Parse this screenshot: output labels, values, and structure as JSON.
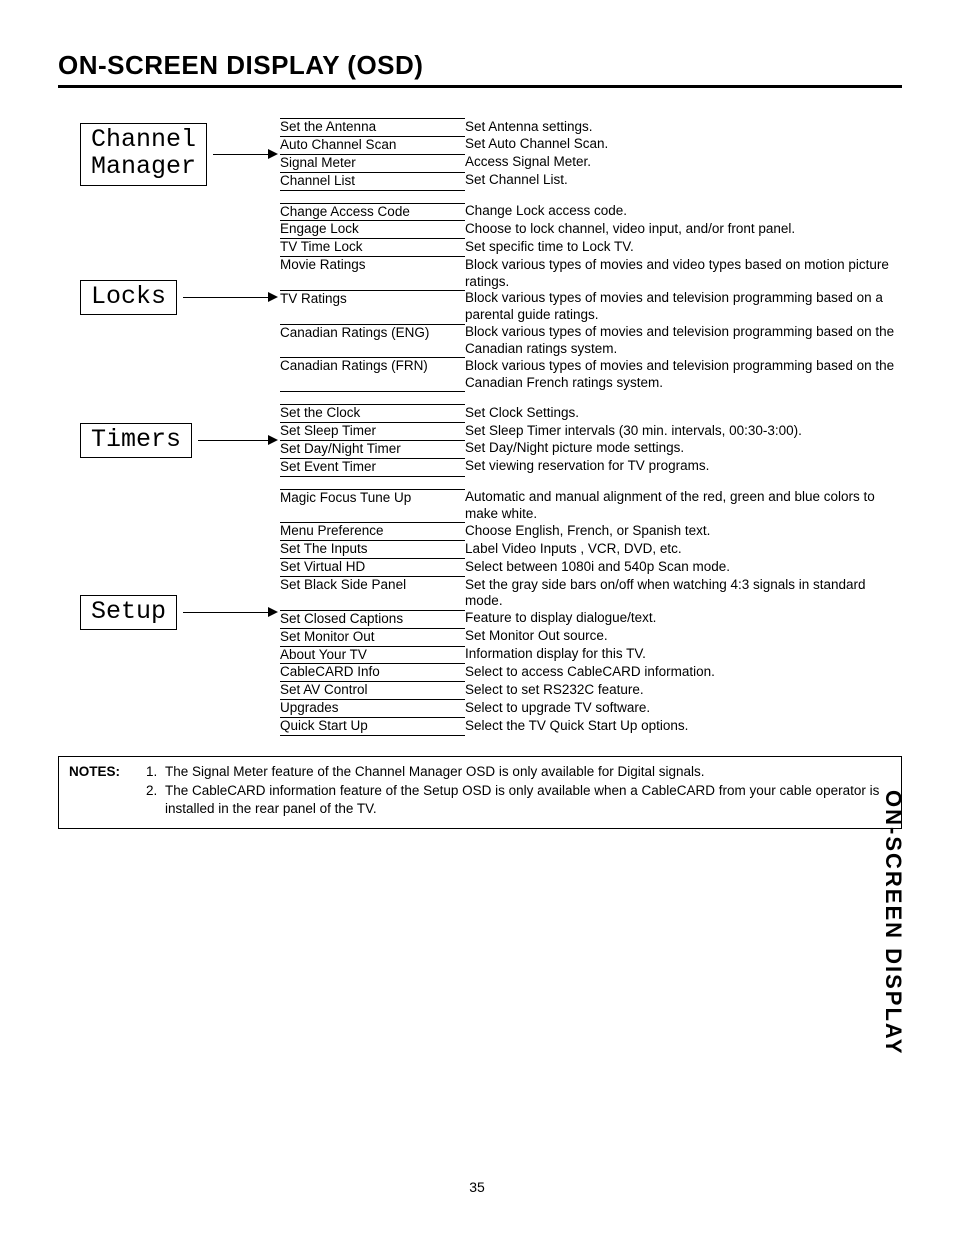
{
  "title": "ON-SCREEN DISPLAY (OSD)",
  "side_tab": "ON-SCREEN DISPLAY",
  "page_number": "35",
  "sections": [
    {
      "label": "Channel\nManager",
      "items": [
        {
          "name": "Set the Antenna",
          "desc": "Set Antenna settings."
        },
        {
          "name": "Auto Channel Scan",
          "desc": "Set Auto Channel Scan."
        },
        {
          "name": "Signal Meter",
          "desc": "Access Signal Meter."
        },
        {
          "name": "Channel List",
          "desc": "Set Channel List."
        }
      ]
    },
    {
      "label": "Locks",
      "items": [
        {
          "name": "Change Access Code",
          "desc": "Change Lock access code."
        },
        {
          "name": "Engage Lock",
          "desc": "Choose to lock channel, video input, and/or front panel."
        },
        {
          "name": "TV Time Lock",
          "desc": "Set specific time to Lock TV."
        },
        {
          "name": "Movie Ratings",
          "desc": "Block various types of movies and video types based on motion picture ratings."
        },
        {
          "name": "TV Ratings",
          "desc": "Block various types of movies and television programming based on a parental guide ratings."
        },
        {
          "name": "Canadian Ratings (ENG)",
          "desc": "Block various types of movies and television programming based on the Canadian ratings system."
        },
        {
          "name": "Canadian Ratings (FRN)",
          "desc": "Block various types of movies and television programming based on the Canadian French ratings system."
        }
      ]
    },
    {
      "label": "Timers",
      "items": [
        {
          "name": "Set the Clock",
          "desc": "Set Clock Settings."
        },
        {
          "name": "Set Sleep Timer",
          "desc": "Set Sleep Timer intervals (30 min. intervals, 00:30-3:00)."
        },
        {
          "name": "Set Day/Night Timer",
          "desc": "Set Day/Night picture mode settings."
        },
        {
          "name": "Set Event Timer",
          "desc": "Set viewing reservation for TV programs."
        }
      ]
    },
    {
      "label": "Setup",
      "items": [
        {
          "name": "Magic Focus Tune Up",
          "desc": "Automatic and manual alignment of the red, green and blue colors to make white."
        },
        {
          "name": "Menu Preference",
          "desc": "Choose English, French, or Spanish text."
        },
        {
          "name": "Set The Inputs",
          "desc": "Label Video Inputs , VCR, DVD, etc."
        },
        {
          "name": "Set Virtual HD",
          "desc": "Select between 1080i and 540p Scan mode."
        },
        {
          "name": "Set Black Side Panel",
          "desc": "Set the gray side bars on/off when watching 4:3 signals in standard mode."
        },
        {
          "name": "Set Closed Captions",
          "desc": "Feature to display dialogue/text."
        },
        {
          "name": "Set Monitor Out",
          "desc": "Set Monitor Out source."
        },
        {
          "name": "About Your TV",
          "desc": "Information display for this TV."
        },
        {
          "name": "CableCARD Info",
          "desc": "Select to access CableCARD information."
        },
        {
          "name": "Set AV Control",
          "desc": "Select to set RS232C feature."
        },
        {
          "name": "Upgrades",
          "desc": "Select to upgrade TV software."
        },
        {
          "name": "Quick Start Up",
          "desc": "Select the TV Quick Start Up options."
        }
      ]
    }
  ],
  "notes_label": "NOTES:",
  "notes": [
    "The Signal Meter feature of the Channel Manager OSD is only available for Digital signals.",
    "The CableCARD information feature of the Setup OSD is only available when a CableCARD from your cable operator is installed in the rear panel of the TV."
  ]
}
